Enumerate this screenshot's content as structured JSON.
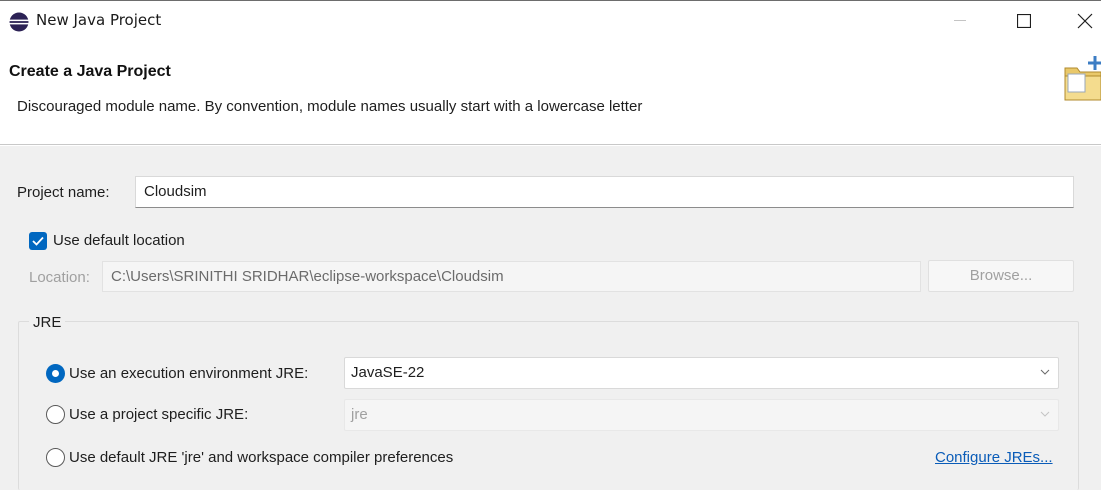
{
  "window": {
    "title": "New Java Project",
    "app_icon": "eclipse-icon",
    "controls": [
      "minimize-icon",
      "maximize-icon",
      "close-icon"
    ]
  },
  "banner": {
    "title": "Create a Java Project",
    "message": "Discouraged module name. By convention, module names usually start with a lowercase letter",
    "icon": "new-java-project-wizard-icon"
  },
  "project": {
    "name_label": "Project name:",
    "name_value": "Cloudsim"
  },
  "location": {
    "use_default_label": "Use default location",
    "use_default_checked": true,
    "label": "Location:",
    "value": "C:\\Users\\SRINITHI SRIDHAR\\eclipse-workspace\\Cloudsim",
    "browse_label": "Browse..."
  },
  "jre": {
    "group_title": "JRE",
    "options": [
      {
        "label": "Use an execution environment JRE:",
        "selected": true,
        "combo_value": "JavaSE-22",
        "combo_enabled": true
      },
      {
        "label": "Use a project specific JRE:",
        "selected": false,
        "combo_value": "jre",
        "combo_enabled": false
      },
      {
        "label": "Use default JRE 'jre' and workspace compiler preferences",
        "selected": false
      }
    ],
    "configure_link": "Configure JREs..."
  },
  "colors": {
    "accent": "#0067c0",
    "link": "#0a5cb8",
    "panel_bg": "#f0f0f0",
    "disabled_text": "#a0a0a0"
  }
}
